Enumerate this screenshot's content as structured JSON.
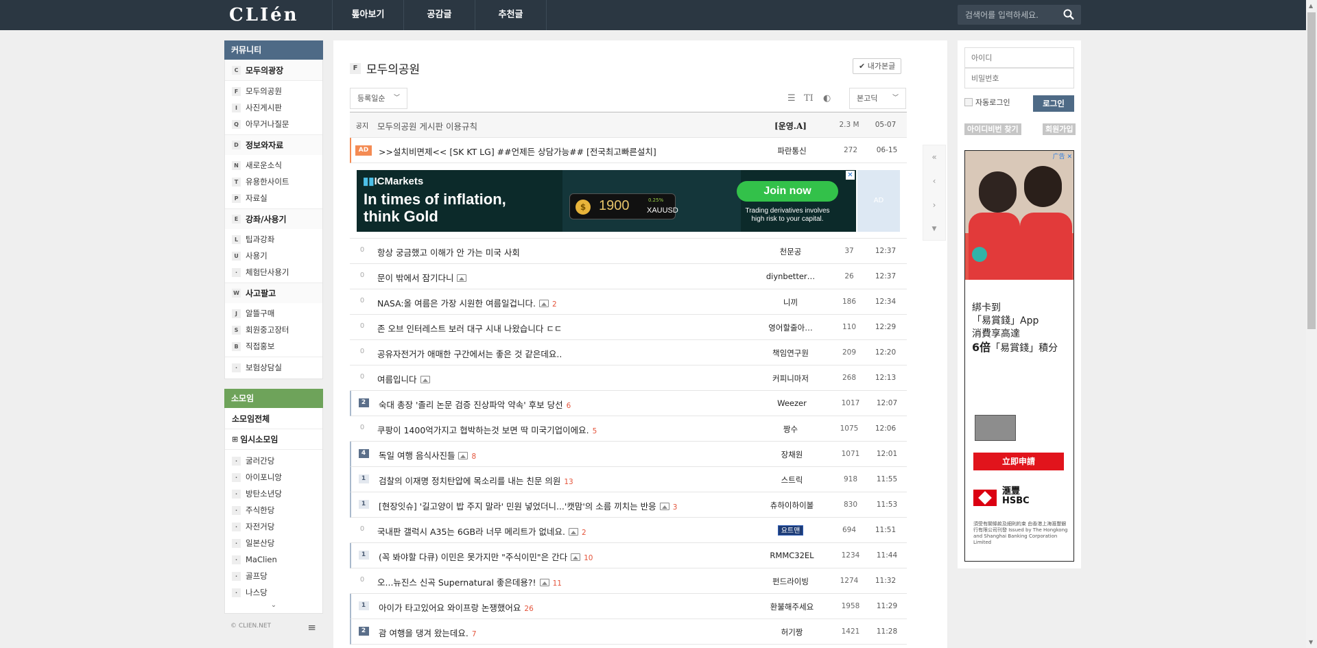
{
  "header": {
    "logo": "CLIén",
    "nav": [
      "톺아보기",
      "공감글",
      "추천글"
    ],
    "search_placeholder": "검색어를 입력하세요."
  },
  "sidebar": {
    "community_label": "커뮤니티",
    "groups": [
      {
        "letter": "C",
        "title": "모두의광장",
        "items": []
      },
      {
        "letter": "",
        "title": "",
        "items": [
          {
            "letter": "F",
            "label": "모두의공원"
          },
          {
            "letter": "I",
            "label": "사진게시판"
          },
          {
            "letter": "Q",
            "label": "아무거나질문"
          }
        ]
      },
      {
        "letter": "D",
        "title": "정보와자료",
        "items": [
          {
            "letter": "N",
            "label": "새로운소식"
          },
          {
            "letter": "T",
            "label": "유용한사이트"
          },
          {
            "letter": "P",
            "label": "자료실"
          }
        ]
      },
      {
        "letter": "E",
        "title": "강좌/사용기",
        "items": [
          {
            "letter": "L",
            "label": "팁과강좌"
          },
          {
            "letter": "U",
            "label": "사용기"
          },
          {
            "letter": "·",
            "label": "체험단사용기"
          }
        ]
      },
      {
        "letter": "W",
        "title": "사고팔고",
        "items": [
          {
            "letter": "J",
            "label": "알뜰구매"
          },
          {
            "letter": "S",
            "label": "회원중고장터"
          },
          {
            "letter": "B",
            "label": "직접홍보"
          }
        ]
      },
      {
        "letter": "",
        "title": "",
        "items": [
          {
            "letter": "·",
            "label": "보험상담실"
          }
        ]
      }
    ],
    "somoim_label": "소모임",
    "somoim_all": "소모임전체",
    "somoim_temp": "임시소모임",
    "somoim_items": [
      "굴러간당",
      "아이포니앙",
      "방탄소년당",
      "주식한당",
      "자전거당",
      "일본산당",
      "MaClien",
      "골프당",
      "나스당"
    ],
    "copyright": "© CLIEN.NET"
  },
  "board": {
    "letter": "F",
    "title": "모두의공원",
    "my_posts": "내가본글",
    "sort_label": "등록일순",
    "view_label": "본고딕"
  },
  "posts": [
    {
      "type": "notice",
      "num": "공지",
      "title": "모두의공원 게시판 이용규칙",
      "author": "[운영.A]",
      "hits": "2.3 M",
      "time": "05-07"
    },
    {
      "type": "ad",
      "num": "AD",
      "title": ">>설치비면제<< [SK KT LG] ##언제든 상담가능## [전국최고빠른설치]",
      "author": "파란통신",
      "hits": "272",
      "time": "06-15"
    },
    {
      "type": "normal",
      "num": "0",
      "title": "항상 궁금했고 이해가 안 가는 미국 사회",
      "img": false,
      "comments": "",
      "author": "천문공",
      "hits": "37",
      "time": "12:37"
    },
    {
      "type": "normal",
      "num": "0",
      "title": "문이 밖에서 잠기다니",
      "img": true,
      "comments": "",
      "author": "diynbetter…",
      "hits": "26",
      "time": "12:37"
    },
    {
      "type": "normal",
      "num": "0",
      "title": "NASA:올 여름은 가장 시원한 여름일겁니다.",
      "img": true,
      "comments": "2",
      "author": "니끼",
      "hits": "186",
      "time": "12:34"
    },
    {
      "type": "normal",
      "num": "0",
      "title": "존 오브 인터레스트 보러 대구 시내 나왔습니다 ㄷㄷ",
      "img": false,
      "comments": "",
      "author": "영어할줄아…",
      "hits": "110",
      "time": "12:29"
    },
    {
      "type": "normal",
      "num": "0",
      "title": "공유자전거가 애매한 구간에서는 좋은 것 같은데요..",
      "img": false,
      "comments": "",
      "author": "책임연구원",
      "hits": "209",
      "time": "12:20"
    },
    {
      "type": "normal",
      "num": "0",
      "title": "여름입니다",
      "img": true,
      "comments": "",
      "author": "커피니마저",
      "hits": "268",
      "time": "12:13"
    },
    {
      "type": "pop",
      "num": "2",
      "title": "숙대 총장 '졸리 논문 검증 진상파악 약속' 후보 당선",
      "img": false,
      "comments": "6",
      "author": "Weezer",
      "hits": "1017",
      "time": "12:07"
    },
    {
      "type": "normal",
      "num": "0",
      "title": "쿠팡이 1400억가지고 협박하는것 보면 딱 미국기업이에요.",
      "img": false,
      "comments": "5",
      "author": "짱수",
      "hits": "1075",
      "time": "12:06"
    },
    {
      "type": "pop",
      "num": "4",
      "title": "독일 여행 음식사진들",
      "img": true,
      "comments": "8",
      "author": "장채원",
      "hits": "1071",
      "time": "12:01"
    },
    {
      "type": "recom",
      "num": "1",
      "title": "검찰의 이재명 정치탄압에 목소리를 내는 친문 의원",
      "img": false,
      "comments": "13",
      "author": "스트릭",
      "hits": "918",
      "time": "11:55"
    },
    {
      "type": "recom",
      "num": "1",
      "title": "[현장잇슈] '길고양이 밥 주지 말라' 민원 넣었더니...'캣맘'의 소름 끼치는 반응",
      "img": true,
      "comments": "3",
      "author": "츄하이하이볼",
      "hits": "830",
      "time": "11:53"
    },
    {
      "type": "normal",
      "num": "0",
      "title": "국내판 갤럭시 A35는 6GB라 너무 메리트가 없네요.",
      "img": true,
      "comments": "2",
      "author": "요트맨",
      "authorBadge": true,
      "hits": "694",
      "time": "11:51"
    },
    {
      "type": "recom",
      "num": "1",
      "title": "(꼭 봐야할 다큐) 이민은 못가지만 \"주식이민\"은 간다",
      "img": true,
      "comments": "10",
      "author": "RMMC32EL",
      "hits": "1234",
      "time": "11:44"
    },
    {
      "type": "normal",
      "num": "0",
      "title": "오...뉴진스 신곡 Supernatural 좋은데용?!",
      "img": true,
      "comments": "11",
      "author": "펀드라이빙",
      "hits": "1274",
      "time": "11:32"
    },
    {
      "type": "recom",
      "num": "1",
      "title": "아이가 타고있어요 와이프랑 논쟁했어요",
      "img": false,
      "comments": "26",
      "author": "환불해주세요",
      "hits": "1958",
      "time": "11:29"
    },
    {
      "type": "pop",
      "num": "2",
      "title": "괌 여행을 댕겨 왔는데요.",
      "img": false,
      "comments": "7",
      "author": "허기짱",
      "hits": "1421",
      "time": "11:28"
    }
  ],
  "inline_ad": {
    "brand": "ICMarkets",
    "headline_1": "In times of inflation,",
    "headline_2": "think Gold",
    "price": "1900",
    "change": "0.25%",
    "symbol": "XAUUSD",
    "cta": "Join now",
    "sub_1": "Trading derivatives involves",
    "sub_2": "high risk to your capital.",
    "side_label": "AD"
  },
  "login": {
    "id_placeholder": "아이디",
    "pw_placeholder": "비밀번호",
    "auto_login": "자동로그인",
    "login_button": "로그인",
    "find_id": "아이디비번 찾기",
    "join": "회원가입"
  },
  "side_ad": {
    "tag": "广告",
    "line1": "綁卡到",
    "line2": "「易賞錢」App",
    "line3": "消費享高達",
    "line4a": "6倍",
    "line4b": "「易賞錢」積分",
    "apply": "立即申請",
    "brand_cn": "滙豐",
    "brand": "HSBC",
    "fine": "須受有關條款及細則約束 由香港上海滙豐銀行有限公司刊發 Issued by The Hongkong and Shanghai Banking Corporation Limited"
  },
  "icons": {
    "search": "search-icon",
    "menu": "menu-icon",
    "check": "check-circle-icon"
  }
}
